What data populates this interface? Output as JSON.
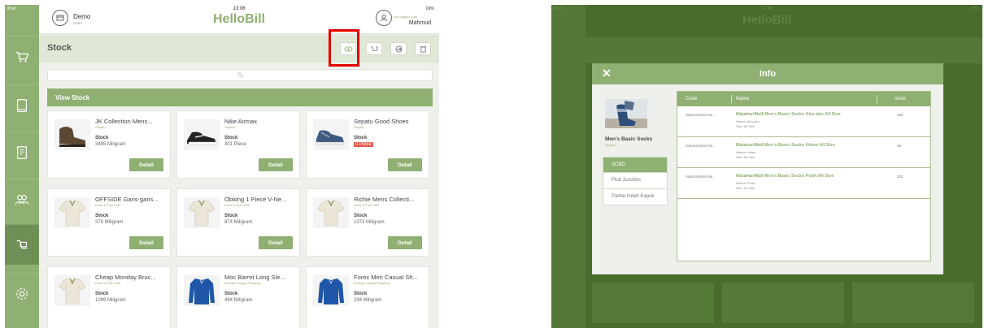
{
  "left": {
    "status": {
      "device": "iPad",
      "time": "13:06",
      "battery": "69%"
    },
    "brand": "HelloBill",
    "store": {
      "name": "Demo",
      "sub": "SCBD"
    },
    "user": {
      "note": "you logged in as",
      "name": "Mahmud"
    },
    "page_title": "Stock",
    "search_placeholder": "",
    "section_title": "View Stock",
    "detail_label": "Detail",
    "stock_label": "Stock",
    "products": [
      {
        "name": "JK Collection Mens...",
        "category": "Sepatu",
        "stock": "3485 Miligram",
        "zero": false,
        "thumb": "boot"
      },
      {
        "name": "Nike Airmax",
        "category": "Sepatu",
        "stock": "301 Piece",
        "zero": false,
        "thumb": "sneaker"
      },
      {
        "name": "Sepatu Good Shoes",
        "category": "Sepatu",
        "stock": "0 Piece",
        "zero": true,
        "thumb": "shoe-blue"
      },
      {
        "name": "OFFSIDE Garis-garis...",
        "category": "Kaos & Polo Shirt",
        "stock": "379 Miligram",
        "zero": false,
        "thumb": "polo"
      },
      {
        "name": "Oblong 1 Piece V-Ne...",
        "category": "Kaos & Polo Shirt",
        "stock": "874 Miligram",
        "zero": false,
        "thumb": "polo"
      },
      {
        "name": "Richie Mens Collecti...",
        "category": "Kaos & Polo Shirt",
        "stock": "1373 Miligram",
        "zero": false,
        "thumb": "polo"
      },
      {
        "name": "Cheap Monday Bruc...",
        "category": "Kaos & Polo Shirt",
        "stock": "1099 Miligram",
        "zero": false,
        "thumb": "polo"
      },
      {
        "name": "Moc Barret Long Sle...",
        "category": "Kemeja Lengan Panjang",
        "stock": "494 Miligram",
        "zero": false,
        "thumb": "shirt-blue"
      },
      {
        "name": "Forex Men Casual Sh...",
        "category": "Kemeja Lengan Panjang",
        "stock": "294 Miligram",
        "zero": false,
        "thumb": "shirt-blue"
      }
    ]
  },
  "right": {
    "status": {
      "device": "iPad",
      "time": "12:48",
      "battery": "70%"
    },
    "brand": "HelloBill",
    "modal": {
      "title": "Info",
      "close": "✕",
      "product_name": "Men's Basic Socks",
      "product_category": "Sepatu",
      "stores": [
        "SCBD",
        "Pluit Junction",
        "Pantai Indah Kapuk"
      ],
      "active_store_index": 0,
      "columns": {
        "code": "Code",
        "name": "Name",
        "stock": "stock"
      },
      "rows": [
        {
          "code": "MatahariMall Me...",
          "name": "MatahariMall Men's Basic Socks Abu-abu All Size",
          "color": "Warna: Abu-abu",
          "size": "Size: All Size",
          "stock": "100"
        },
        {
          "code": "MatahariMall Me...",
          "name": "MatahariMall Men's Basic Socks Hitam All Size",
          "color": "Warna: Hitam",
          "size": "Size: All Size",
          "stock": "28"
        },
        {
          "code": "MatahariMall Me...",
          "name": "MatahariMall Men's Basic Socks Putih All Size",
          "color": "Warna: Putih",
          "size": "Size: All Size",
          "stock": "103"
        }
      ]
    }
  },
  "colors": {
    "accent": "#8fb072",
    "highlight": "#e30000",
    "zero_stock": "#e25a4a"
  }
}
